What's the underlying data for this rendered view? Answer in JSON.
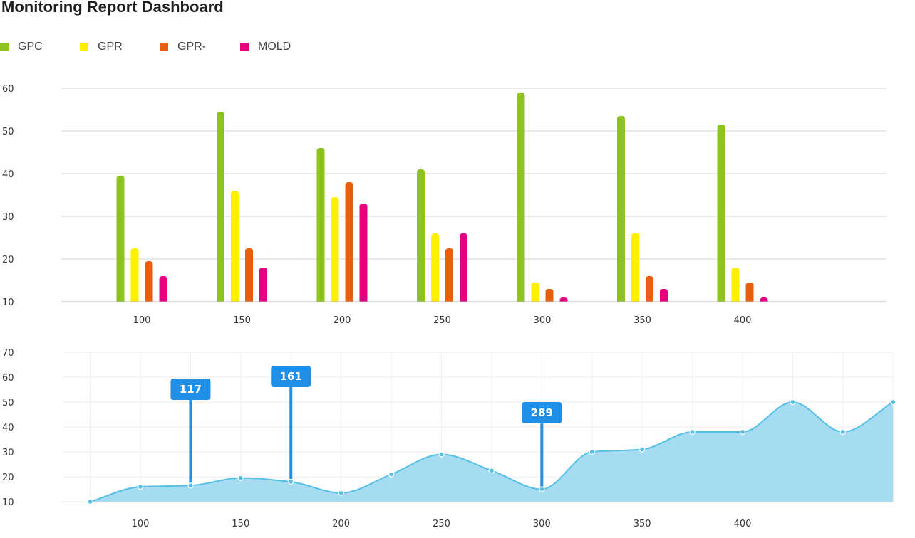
{
  "title": "Monitoring Report Dashboard",
  "legend": [
    {
      "label": "GPC",
      "color": "#8dc21f"
    },
    {
      "label": "GPR",
      "color": "#fff000"
    },
    {
      "label": "GPR-",
      "color": "#e8600f"
    },
    {
      "label": "MOLD",
      "color": "#e4007f"
    }
  ],
  "chart_data": [
    {
      "type": "bar",
      "categories": [
        "100",
        "150",
        "200",
        "250",
        "300",
        "350",
        "400"
      ],
      "series": [
        {
          "name": "GPC",
          "color": "#8dc21f",
          "values": [
            39.5,
            54.5,
            46,
            41,
            59,
            53.5,
            51.5
          ]
        },
        {
          "name": "GPR",
          "color": "#fff000",
          "values": [
            22.5,
            36,
            34.5,
            26,
            14.5,
            26,
            18
          ]
        },
        {
          "name": "GPR-",
          "color": "#e8600f",
          "values": [
            19.5,
            22.5,
            38,
            22.5,
            13,
            16,
            14.5
          ]
        },
        {
          "name": "MOLD",
          "color": "#e4007f",
          "values": [
            16,
            18,
            33,
            26,
            11,
            13,
            11
          ]
        }
      ],
      "yticks": [
        10,
        20,
        30,
        40,
        50,
        60
      ],
      "ylim": [
        10,
        60
      ],
      "xlabel": "",
      "ylabel": "",
      "grid": true,
      "legend_position": "top-left"
    },
    {
      "type": "area",
      "x": [
        75,
        100,
        125,
        150,
        175,
        200,
        225,
        250,
        275,
        300,
        325,
        350,
        375,
        400,
        425,
        450,
        475
      ],
      "values": [
        10,
        16,
        16.5,
        19.5,
        18,
        13.5,
        21,
        29,
        22.5,
        15,
        30,
        31,
        38,
        38,
        50,
        38,
        50
      ],
      "xticks": [
        "100",
        "150",
        "200",
        "250",
        "300",
        "350",
        "400"
      ],
      "yticks": [
        10,
        20,
        30,
        40,
        50,
        60,
        70
      ],
      "ylim": [
        10,
        70
      ],
      "line_color": "#56bfe6",
      "fill_color": "#a6dcf2",
      "grid": true,
      "annotations": [
        {
          "point_index": 2,
          "label": "117",
          "color": "#1f8fe8"
        },
        {
          "point_index": 4,
          "label": "161",
          "color": "#1f8fe8"
        },
        {
          "point_index": 9,
          "label": "289",
          "color": "#1f8fe8"
        }
      ]
    }
  ]
}
